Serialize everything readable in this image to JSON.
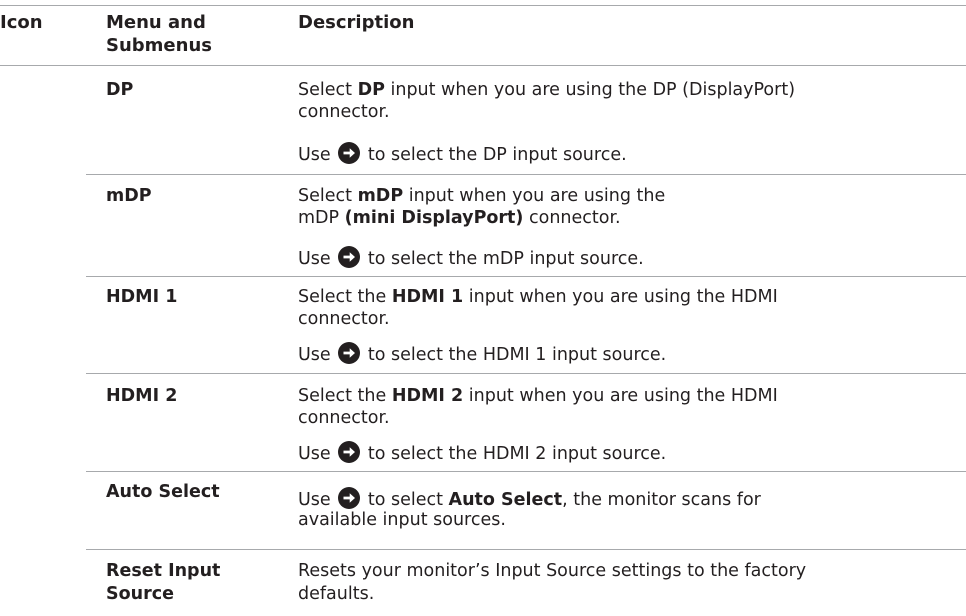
{
  "headers": {
    "icon": "Icon",
    "menu_line1": "Menu and",
    "menu_line2": "Submenus",
    "description": "Description"
  },
  "rows": {
    "dp": {
      "menu": "DP",
      "d1_a": "Select ",
      "d1_b": "DP",
      "d1_c": " input when you are using the DP (DisplayPort)",
      "d1_d": "connector.",
      "use_pre": "Use",
      "use_post": " to select the DP input source."
    },
    "mdp": {
      "menu": "mDP",
      "d1_a": "Select ",
      "d1_b": "mDP",
      "d1_c": " input when you are using the",
      "d2_a": "mDP ",
      "d2_b": "(mini DisplayPort)",
      "d2_c": " connector.",
      "use_pre": "Use",
      "use_post": " to select the mDP input source."
    },
    "hdmi1": {
      "menu": "HDMI 1",
      "d1_a": "Select the ",
      "d1_b": "HDMI 1",
      "d1_c": " input when you are using the HDMI",
      "d1_d": "connector.",
      "use_pre": "Use",
      "use_post": " to select the HDMI 1 input source."
    },
    "hdmi2": {
      "menu": "HDMI 2",
      "d1_a": "Select the ",
      "d1_b": "HDMI 2",
      "d1_c": " input when you are using the HDMI",
      "d1_d": "connector.",
      "use_pre": "Use",
      "use_post": " to select the HDMI 2 input source."
    },
    "auto": {
      "menu": "Auto Select",
      "use_pre": "Use",
      "d1_a": " to select ",
      "d1_b": "Auto Select",
      "d1_c": ", the monitor scans for",
      "d2": "available input sources."
    },
    "reset": {
      "menu_line1": "Reset Input",
      "menu_line2": "Source",
      "d1": "Resets your monitor’s Input Source settings to the factory",
      "d2": "defaults."
    }
  },
  "icons": {
    "arrow": "right-arrow-circle-icon"
  },
  "colors": {
    "text": "#231f20",
    "rule": "#a7a9ac"
  }
}
